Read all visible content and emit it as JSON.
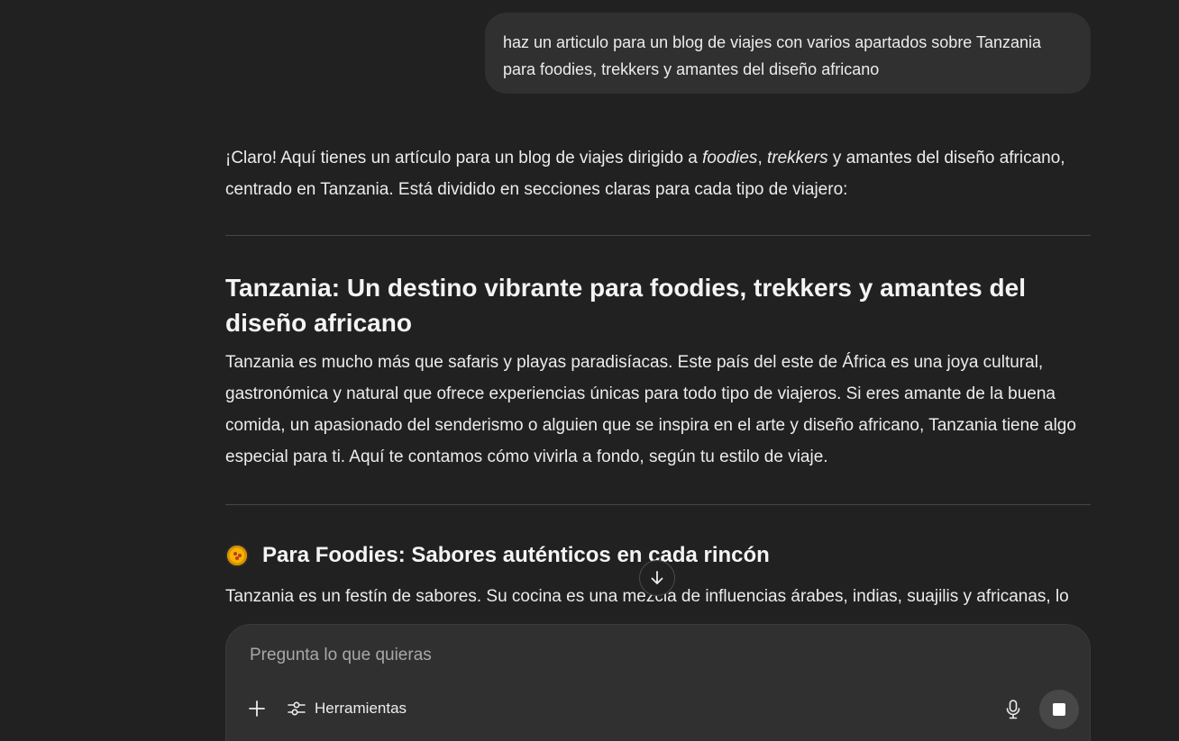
{
  "user_message": "haz un articulo para un blog de viajes con varios apartados sobre Tanzania para foodies, trekkers y amantes del diseño africano",
  "assistant": {
    "intro": {
      "part1": "¡Claro! Aquí tienes un artículo para un blog de viajes dirigido a ",
      "em1": "foodies",
      "sep": ", ",
      "em2": "trekkers",
      "part2": " y amantes del diseño africano, centrado en Tanzania. Está dividido en secciones claras para cada tipo de viajero:"
    },
    "article_title": "Tanzania: Un destino vibrante para foodies, trekkers y amantes del diseño africano",
    "article_body": "Tanzania es mucho más que safaris y playas paradisíacas. Este país del este de África es una joya cultural, gastronómica y natural que ofrece experiencias únicas para todo tipo de viajeros. Si eres amante de la buena comida, un apasionado del senderismo o alguien que se inspira en el arte y diseño africano, Tanzania tiene algo especial para ti. Aquí te contamos cómo vivirla a fondo, según tu estilo de viaje.",
    "section_heading": "Para Foodies: Sabores auténticos en cada rincón",
    "section_icon": "paella-emoji-icon",
    "section_body": "Tanzania es un festín de sabores. Su cocina es una mezcla de influencias árabes, indias, suajilis y africanas, lo"
  },
  "composer": {
    "placeholder": "Pregunta lo que quieras",
    "tools_label": "Herramientas"
  },
  "icons": {
    "scroll": "arrow-down-icon",
    "plus": "plus-icon",
    "tools": "sliders-icon",
    "mic": "microphone-icon",
    "stop": "stop-icon"
  }
}
